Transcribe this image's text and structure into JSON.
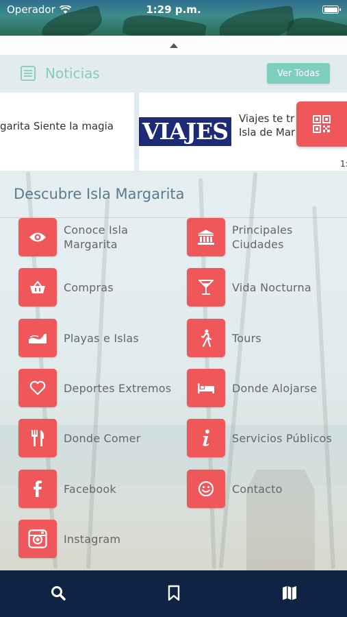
{
  "status_bar": {
    "carrier": "Operador",
    "time": "1:29 p.m."
  },
  "news": {
    "title": "Noticias",
    "view_all": "Ver Todas",
    "cards": [
      {
        "text": "garita Siente la magia"
      },
      {
        "logo_text": "VIAJES",
        "text_line1": "Viajes te tr",
        "text_line2": "Isla de Mar"
      }
    ],
    "overflow_text": "1:"
  },
  "section": {
    "title": "Descubre Isla Margarita"
  },
  "menu": {
    "items": [
      {
        "label_line1": "Conoce Isla",
        "label_line2": "Margarita",
        "icon": "eye-icon"
      },
      {
        "label_line1": "Principales",
        "label_line2": "Ciudades",
        "icon": "building-icon"
      },
      {
        "label": "Compras",
        "icon": "basket-icon"
      },
      {
        "label": "Vida Nocturna",
        "icon": "cocktail-icon"
      },
      {
        "label": "Playas e Islas",
        "icon": "wave-icon"
      },
      {
        "label": "Tours",
        "icon": "walking-icon"
      },
      {
        "label": "Deportes Extremos",
        "icon": "heart-icon"
      },
      {
        "label": "Donde Alojarse",
        "icon": "bed-icon"
      },
      {
        "label": "Donde Comer",
        "icon": "cutlery-icon"
      },
      {
        "label": "Servicios Públicos",
        "icon": "info-icon"
      },
      {
        "label": "Facebook",
        "icon": "facebook-icon"
      },
      {
        "label": "Contacto",
        "icon": "smile-icon"
      },
      {
        "label": "Instagram",
        "icon": "instagram-icon"
      }
    ]
  },
  "tabbar": {
    "tabs": [
      {
        "icon": "search-icon"
      },
      {
        "icon": "bookmark-icon"
      },
      {
        "icon": "map-icon"
      }
    ]
  },
  "colors": {
    "accent": "#f0575b",
    "teal": "#7fcfbf",
    "navy": "#0f2344"
  }
}
